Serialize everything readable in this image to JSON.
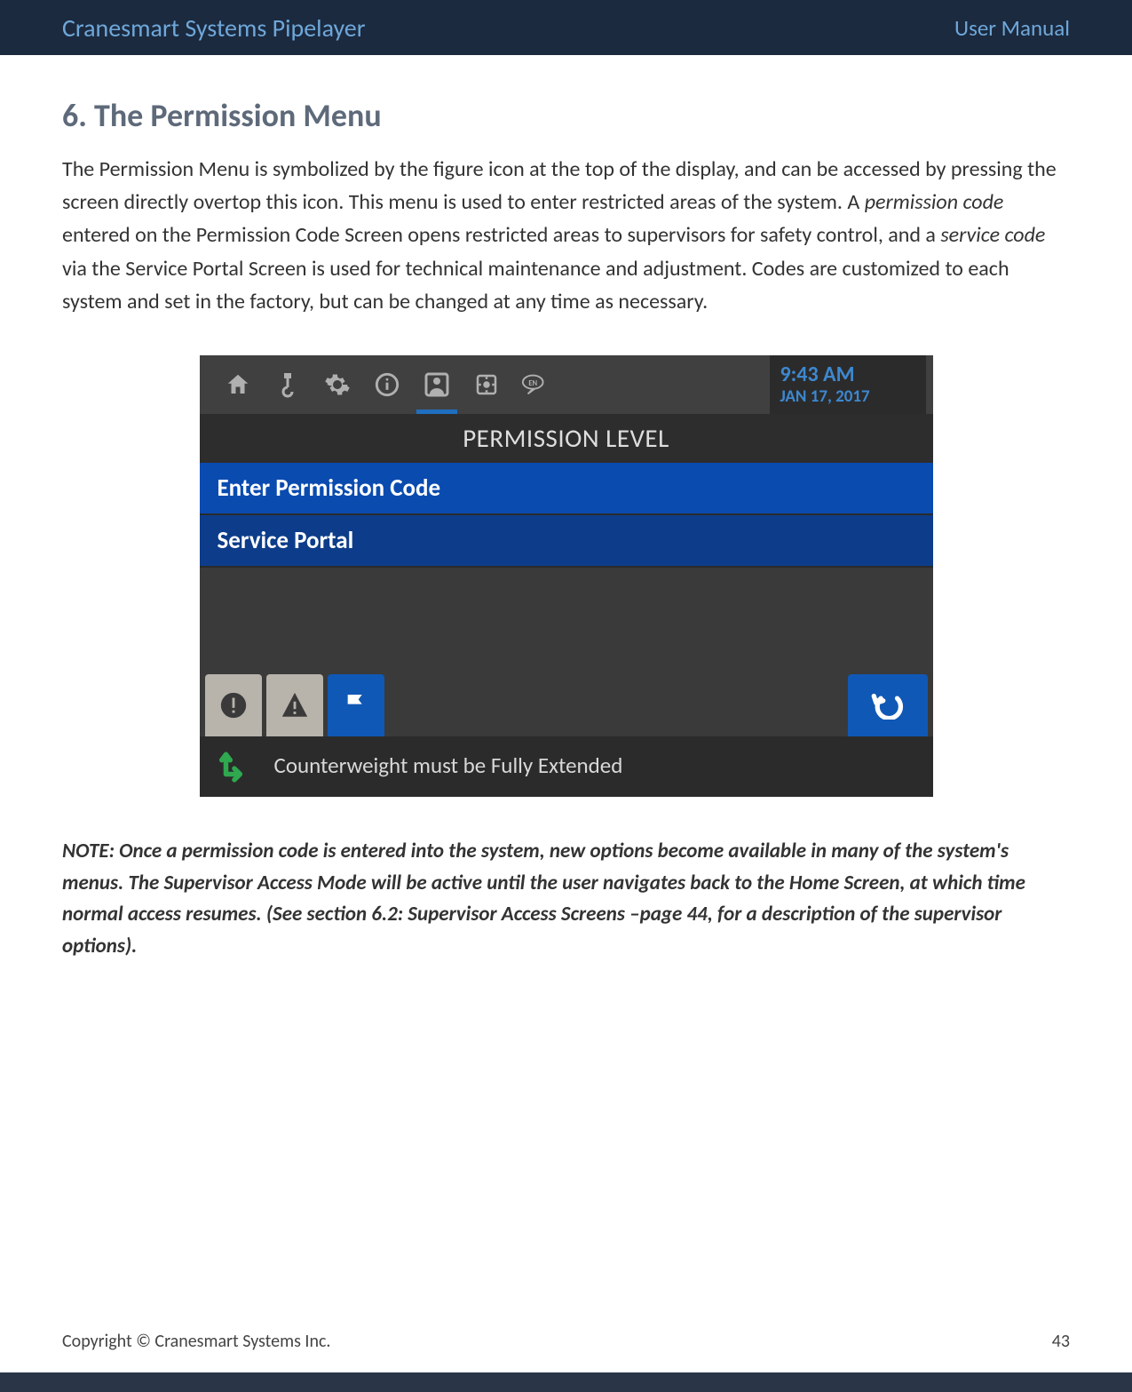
{
  "header": {
    "title": "Cranesmart Systems Pipelayer",
    "right": "User Manual"
  },
  "section": {
    "heading": "6. The Permission Menu",
    "body_html": "The Permission Menu is symbolized by the figure icon at the top of the display, and can be accessed by pressing the screen directly overtop this icon.  This menu is used to enter restricted areas of the system.  A <em>permission code</em> entered on the Permission Code Screen opens restricted areas to supervisors for safety control, and a <em>service code</em> via the Service Portal Screen is used for technical maintenance and adjustment.  Codes are customized to each system and set in the factory, but can be changed at any time as necessary.",
    "note": "NOTE:  Once a permission code is entered into the system, new options become available in many of the system's menus.  The Supervisor Access Mode will be active until the user navigates back to the Home Screen, at which time normal access resumes.  (See section 6.2: Supervisor Access Screens –page 44, for a description of the supervisor options)."
  },
  "hmi": {
    "time": "9:43 AM",
    "date": "JAN 17, 2017",
    "screen_title": "PERMISSION LEVEL",
    "menu_items": [
      "Enter Permission Code",
      "Service Portal"
    ],
    "status_message": "Counterweight must be Fully Extended",
    "icons": [
      "home",
      "hook",
      "gear",
      "info",
      "person",
      "brightness",
      "language"
    ],
    "bottom_buttons": [
      "alert-circle",
      "warning-triangle",
      "flag",
      "back"
    ]
  },
  "footer": {
    "copyright": "Copyright © Cranesmart Systems Inc.",
    "page": "43"
  }
}
